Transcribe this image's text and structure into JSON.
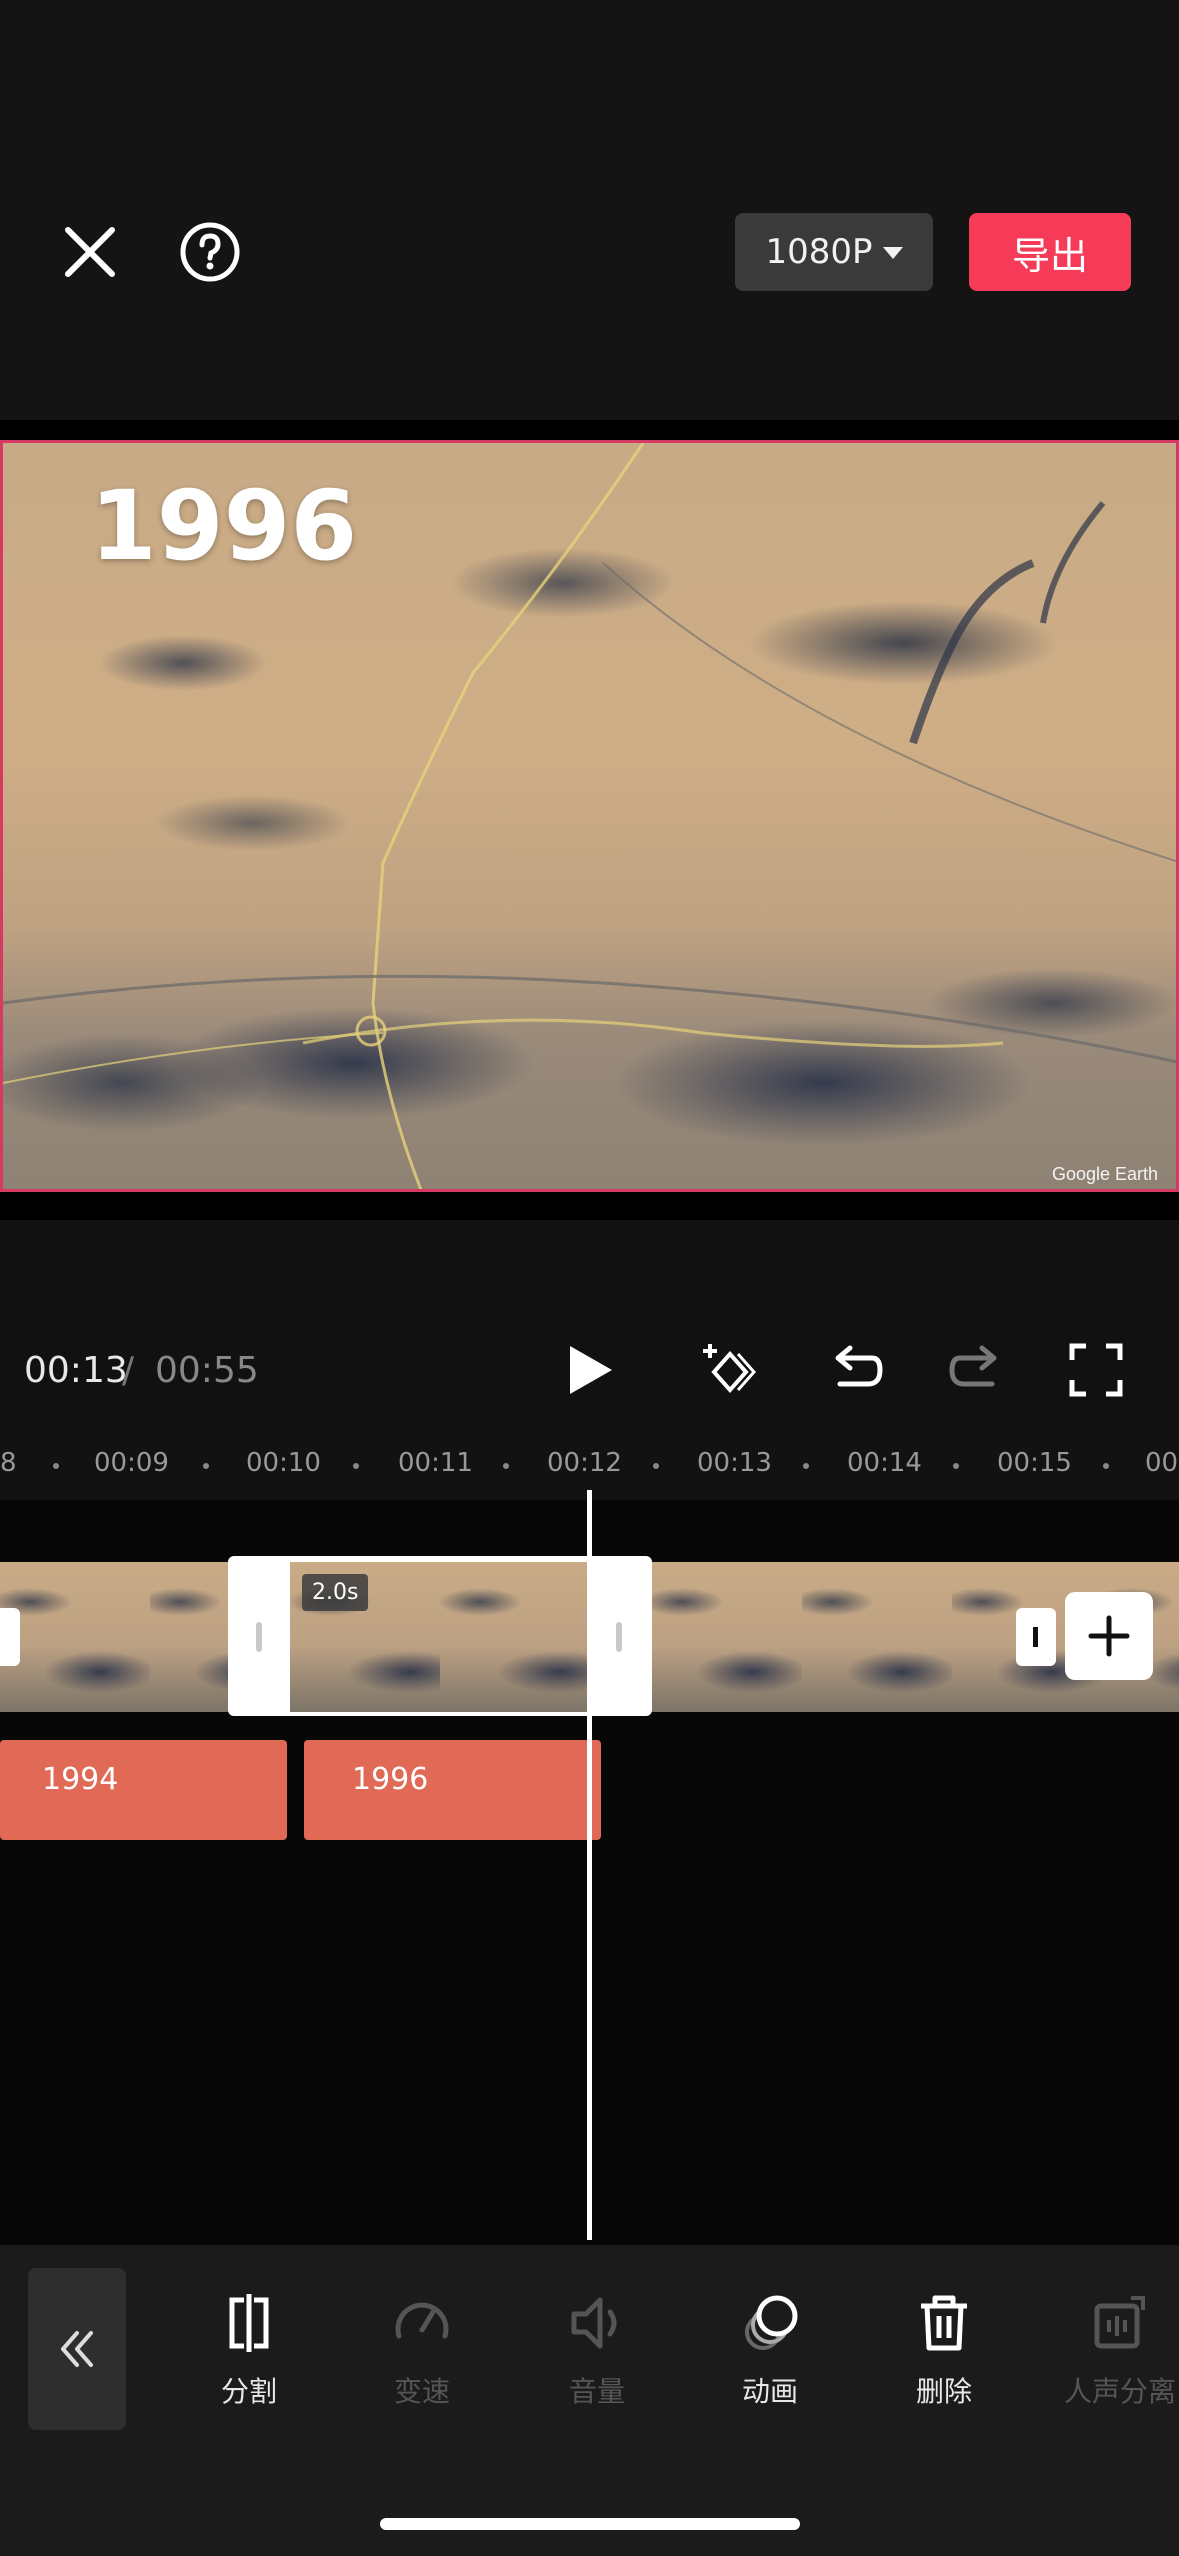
{
  "header": {
    "resolution": "1080P",
    "export_label": "导出"
  },
  "preview": {
    "overlay_text": "1996",
    "watermark": "Google Earth"
  },
  "playback": {
    "current_time": "00:13",
    "separator": "/",
    "total_time": "00:55"
  },
  "ruler": {
    "ticks": [
      "8",
      "00:09",
      "00:10",
      "00:11",
      "00:12",
      "00:13",
      "00:14",
      "00:15",
      "00"
    ]
  },
  "video_track": {
    "selected_clip_duration": "2.0s"
  },
  "text_track": {
    "clips": [
      "1994",
      "1996"
    ]
  },
  "toolbar": {
    "items": [
      {
        "label": "分割",
        "icon": "split-icon",
        "enabled": true
      },
      {
        "label": "变速",
        "icon": "speed-icon",
        "enabled": false
      },
      {
        "label": "音量",
        "icon": "volume-icon",
        "enabled": false
      },
      {
        "label": "动画",
        "icon": "animation-icon",
        "enabled": true
      },
      {
        "label": "删除",
        "icon": "delete-icon",
        "enabled": true
      },
      {
        "label": "人声分离",
        "icon": "vocal-separation-icon",
        "enabled": false
      }
    ]
  },
  "colors": {
    "accent": "#f53b57",
    "text_clip": "#e06a55",
    "selection_border": "#d63a62"
  }
}
